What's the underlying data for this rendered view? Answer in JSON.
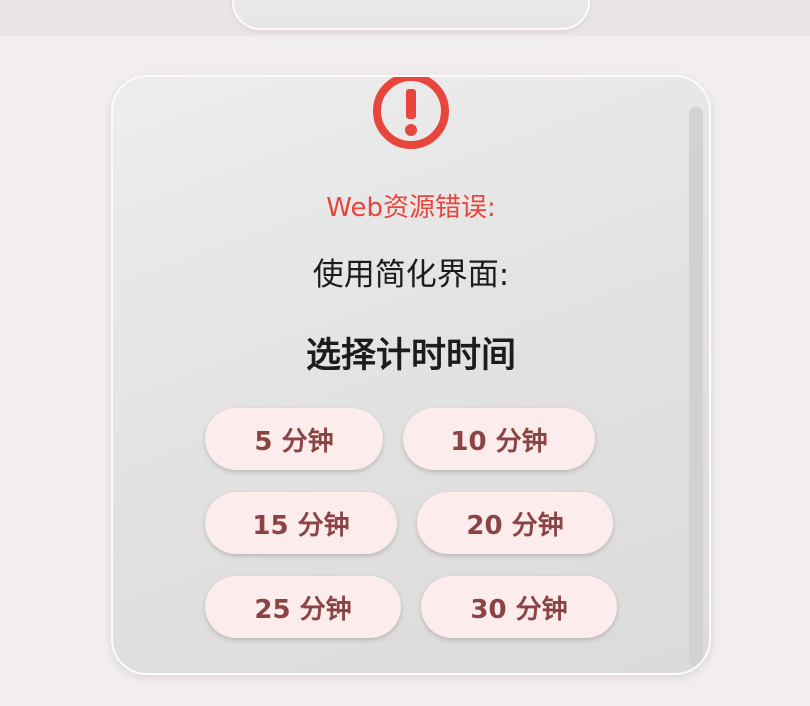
{
  "error": {
    "title": "Web资源错误:",
    "icon": "exclamation-circle-icon",
    "color": "#e8453c"
  },
  "subtitle": "使用简化界面:",
  "heading": "选择计时时间",
  "options": [
    {
      "label": "5 分钟"
    },
    {
      "label": "10 分钟"
    },
    {
      "label": "15 分钟"
    },
    {
      "label": "20 分钟"
    },
    {
      "label": "25 分钟"
    },
    {
      "label": "30 分钟"
    }
  ],
  "colors": {
    "button_bg": "#fcecec",
    "button_text": "#8b4343",
    "heading_text": "#1f1b1b"
  }
}
